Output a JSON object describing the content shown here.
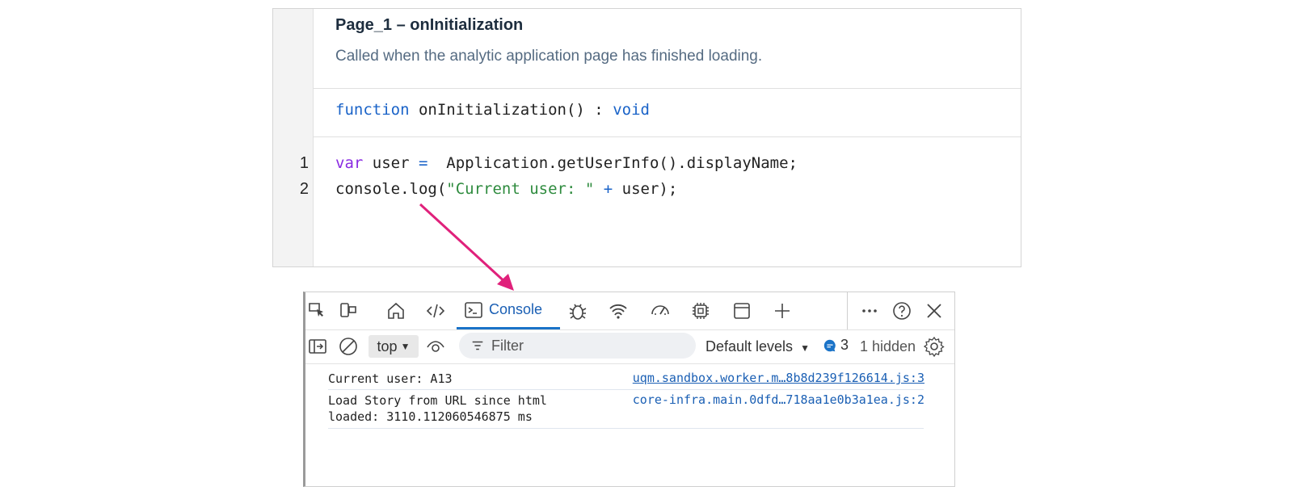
{
  "editor": {
    "title": "Page_1 – onInitialization",
    "description": "Called when the analytic application page has finished loading.",
    "signature": {
      "keyword": "function",
      "name": " onInitialization() : ",
      "return_type": "void"
    },
    "line_numbers": [
      "1",
      "2"
    ],
    "lines": [
      {
        "kw": "var",
        "rest_a": " user ",
        "op": "=",
        "rest_b": "  Application.getUserInfo().displayName;"
      },
      {
        "pre": "console.log(",
        "str": "\"Current user: \"",
        "op": " + ",
        "post": "user);"
      }
    ]
  },
  "devtools": {
    "tabs": {
      "console_label": "Console"
    },
    "icons": [
      "inspect-icon",
      "device-icon",
      "home-icon",
      "elements-icon",
      "console-icon",
      "bug-icon",
      "wifi-icon",
      "performance-icon",
      "memory-icon",
      "application-icon",
      "plus-icon",
      "more-icon",
      "help-icon",
      "close-icon"
    ],
    "toolbar": {
      "context": "top",
      "filter_placeholder": "Filter",
      "levels": "Default levels",
      "message_count": "3",
      "hidden": "1 hidden"
    },
    "logs": [
      {
        "message": "Current user: A13",
        "source": "uqm.sandbox.worker.m…8b8d239f126614.js:3"
      },
      {
        "message": "Load Story from URL since html\nloaded: 3110.112060546875 ms",
        "source": "core-infra.main.0dfd…718aa1e0b3a1ea.js:2"
      }
    ]
  },
  "colors": {
    "accent_blue": "#1a73c8",
    "arrow": "#e0217b",
    "keyword": "#1a63c8",
    "keyword_var": "#8a2be2",
    "string": "#2e8b3e"
  }
}
